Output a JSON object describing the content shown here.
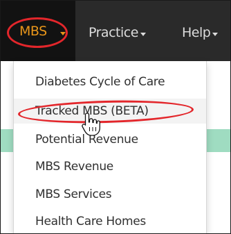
{
  "navbar": {
    "items": [
      {
        "label": "MBS"
      },
      {
        "label": "Practice"
      },
      {
        "label": "Help"
      }
    ]
  },
  "dropdown": {
    "items": [
      {
        "label": "Diabetes Cycle of Care"
      },
      {
        "label": "Tracked MBS (BETA)"
      },
      {
        "label": "Potential Revenue"
      },
      {
        "label": "MBS Revenue"
      },
      {
        "label": "MBS Services"
      },
      {
        "label": "Health Care Homes"
      }
    ]
  },
  "colors": {
    "navbar_bg": "#2a2a2a",
    "active_nav_text": "#e8951a",
    "highlight_circle": "#e3262b",
    "teal_strip": "#9fdcc1"
  },
  "icons": [
    "caret-down-icon",
    "hand-pointer-cursor-icon"
  ]
}
